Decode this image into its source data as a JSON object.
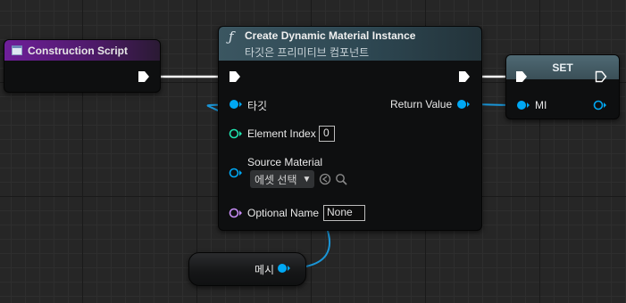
{
  "nodes": {
    "construction_script": {
      "title": "Construction Script"
    },
    "create_dynamic_material_instance": {
      "title": "Create Dynamic Material Instance",
      "subtitle": "타깃은 프리미티브 컴포넌트",
      "pins": {
        "target": "타깃",
        "element_index_label": "Element Index",
        "element_index_value": "0",
        "source_material_label": "Source Material",
        "source_material_value": "에셋 선택",
        "optional_name_label": "Optional Name",
        "optional_name_value": "None",
        "return_value": "Return Value"
      }
    },
    "set": {
      "title": "SET",
      "pin_mi": "MI"
    },
    "mesh_getter": {
      "label": "메시"
    }
  },
  "icons": [
    "function-icon",
    "event-icon",
    "exec-pin-icon",
    "data-pin-icon",
    "chevron-down-icon",
    "use-selected-icon",
    "browse-icon"
  ],
  "colors": {
    "exec": "#ffffff",
    "object_pin": "#00a8f4",
    "int_pin": "#1fe3af",
    "name_pin": "#c78df5",
    "wire_object": "#1a95d6",
    "wire_exec": "#ffffff"
  }
}
